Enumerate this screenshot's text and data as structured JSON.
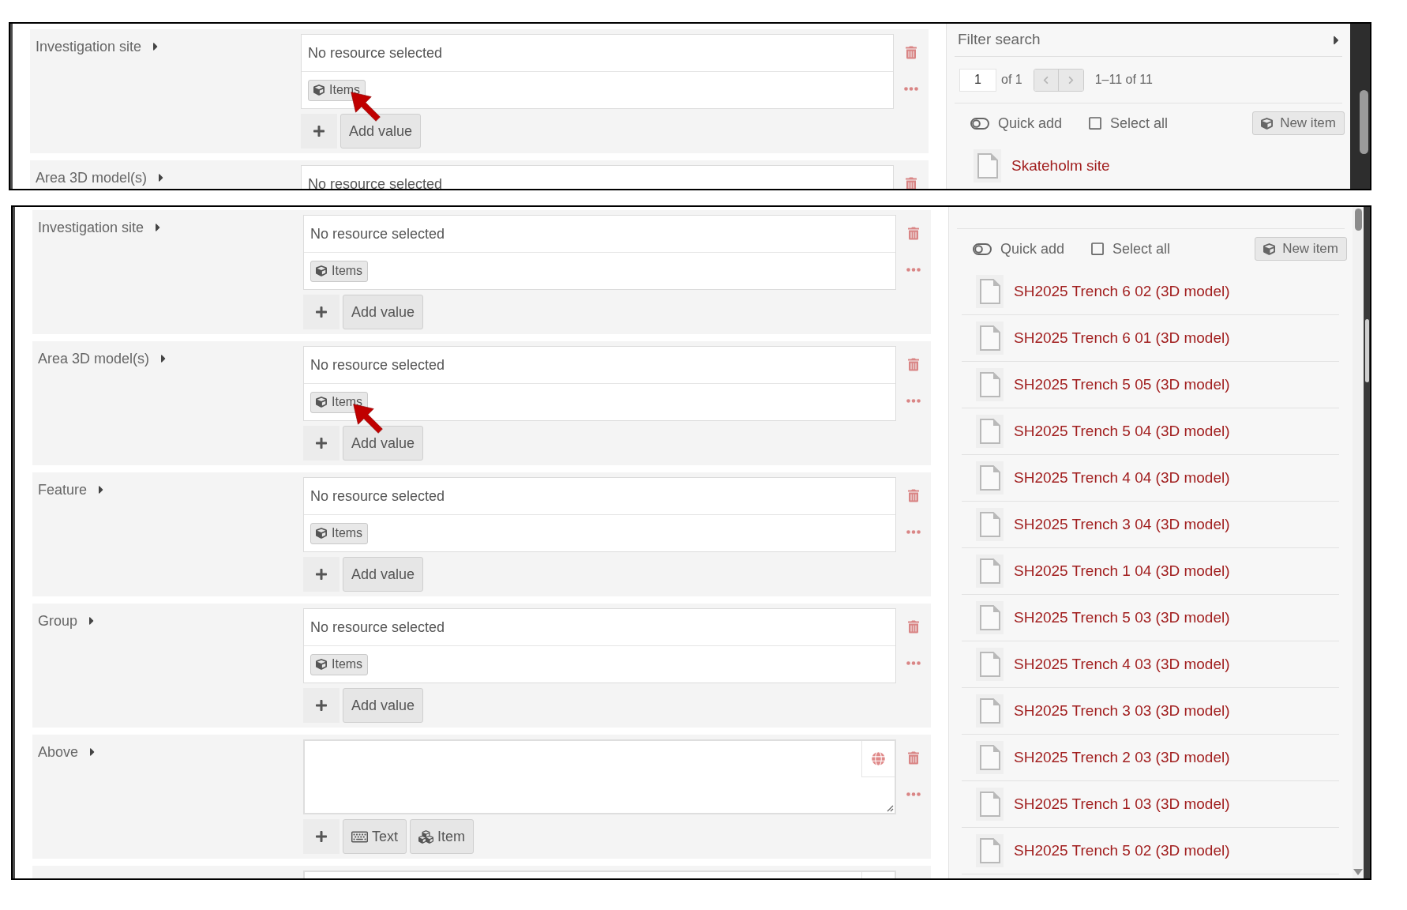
{
  "screenshots": [
    {
      "fields": [
        {
          "label": "Investigation site",
          "kind": "resource",
          "value": "No resource selected",
          "chip": "Items",
          "pointer": true,
          "buttons": [
            {
              "kind": "add",
              "label": "Add value"
            }
          ]
        },
        {
          "label": "Area 3D model(s)",
          "kind": "resource",
          "value": "No resource selected",
          "pointer": false
        }
      ],
      "sidebar": {
        "filter": "Filter search",
        "pagination": {
          "page": "1",
          "total": "of 1",
          "range": "1–11 of 11",
          "prev_enabled": false,
          "next_enabled": false
        },
        "quick_add": {
          "label": "Quick add",
          "on": false
        },
        "select_all": {
          "label": "Select all",
          "checked": false
        },
        "new_item": "New item",
        "items": [
          "Skateholm site"
        ]
      }
    },
    {
      "fields": [
        {
          "label": "Investigation site",
          "kind": "resource",
          "value": "No resource selected",
          "chip": "Items",
          "pointer": false,
          "buttons": [
            {
              "kind": "add",
              "label": "Add value"
            }
          ]
        },
        {
          "label": "Area 3D model(s)",
          "kind": "resource",
          "value": "No resource selected",
          "chip": "Items",
          "pointer": true,
          "buttons": [
            {
              "kind": "add",
              "label": "Add value"
            }
          ]
        },
        {
          "label": "Feature",
          "kind": "resource",
          "value": "No resource selected",
          "chip": "Items",
          "pointer": false,
          "buttons": [
            {
              "kind": "add",
              "label": "Add value"
            }
          ]
        },
        {
          "label": "Group",
          "kind": "resource",
          "value": "No resource selected",
          "chip": "Items",
          "pointer": false,
          "buttons": [
            {
              "kind": "add",
              "label": "Add value"
            }
          ]
        },
        {
          "label": "Above",
          "kind": "text",
          "pointer": false,
          "buttons": [
            {
              "kind": "literal",
              "label": "Text"
            },
            {
              "kind": "resource",
              "label": "Item"
            }
          ]
        },
        {
          "kind": "text"
        }
      ],
      "sidebar": {
        "quick_add": {
          "label": "Quick add",
          "on": false
        },
        "select_all": {
          "label": "Select all",
          "checked": false
        },
        "new_item": "New item",
        "items": [
          "SH2025 Trench 6 02 (3D model)",
          "SH2025 Trench 6 01 (3D model)",
          "SH2025 Trench 5 05 (3D model)",
          "SH2025 Trench 5 04 (3D model)",
          "SH2025 Trench 4 04 (3D model)",
          "SH2025 Trench 3 04 (3D model)",
          "SH2025 Trench 1 04 (3D model)",
          "SH2025 Trench 5 03 (3D model)",
          "SH2025 Trench 4 03 (3D model)",
          "SH2025 Trench 3 03 (3D model)",
          "SH2025 Trench 2 03 (3D model)",
          "SH2025 Trench 1 03 (3D model)",
          "SH2025 Trench 5 02 (3D model)"
        ]
      }
    }
  ]
}
